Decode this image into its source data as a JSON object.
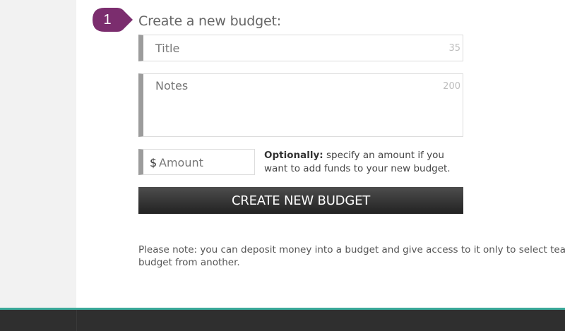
{
  "step": {
    "number": "1",
    "color": "#7b2d6e"
  },
  "form": {
    "heading": "Create a new budget:",
    "title_field": {
      "placeholder": "Title",
      "max_chars": "35"
    },
    "notes_field": {
      "placeholder": "Notes",
      "max_chars": "200"
    },
    "amount_field": {
      "currency_symbol": "$",
      "placeholder": "Amount"
    },
    "optional_note": {
      "bold": "Optionally:",
      "text": " specify an amount if you want to add funds to your new budget."
    },
    "submit_label": "CREATE NEW BUDGET"
  },
  "notice": {
    "line1": "Please note: you can deposit money into a budget and give access to it only to select team m",
    "line2": "budget from another."
  },
  "colors": {
    "accent": "#3aa99a",
    "button": "#2e2e2e",
    "field_bar": "#9c9c9c"
  }
}
